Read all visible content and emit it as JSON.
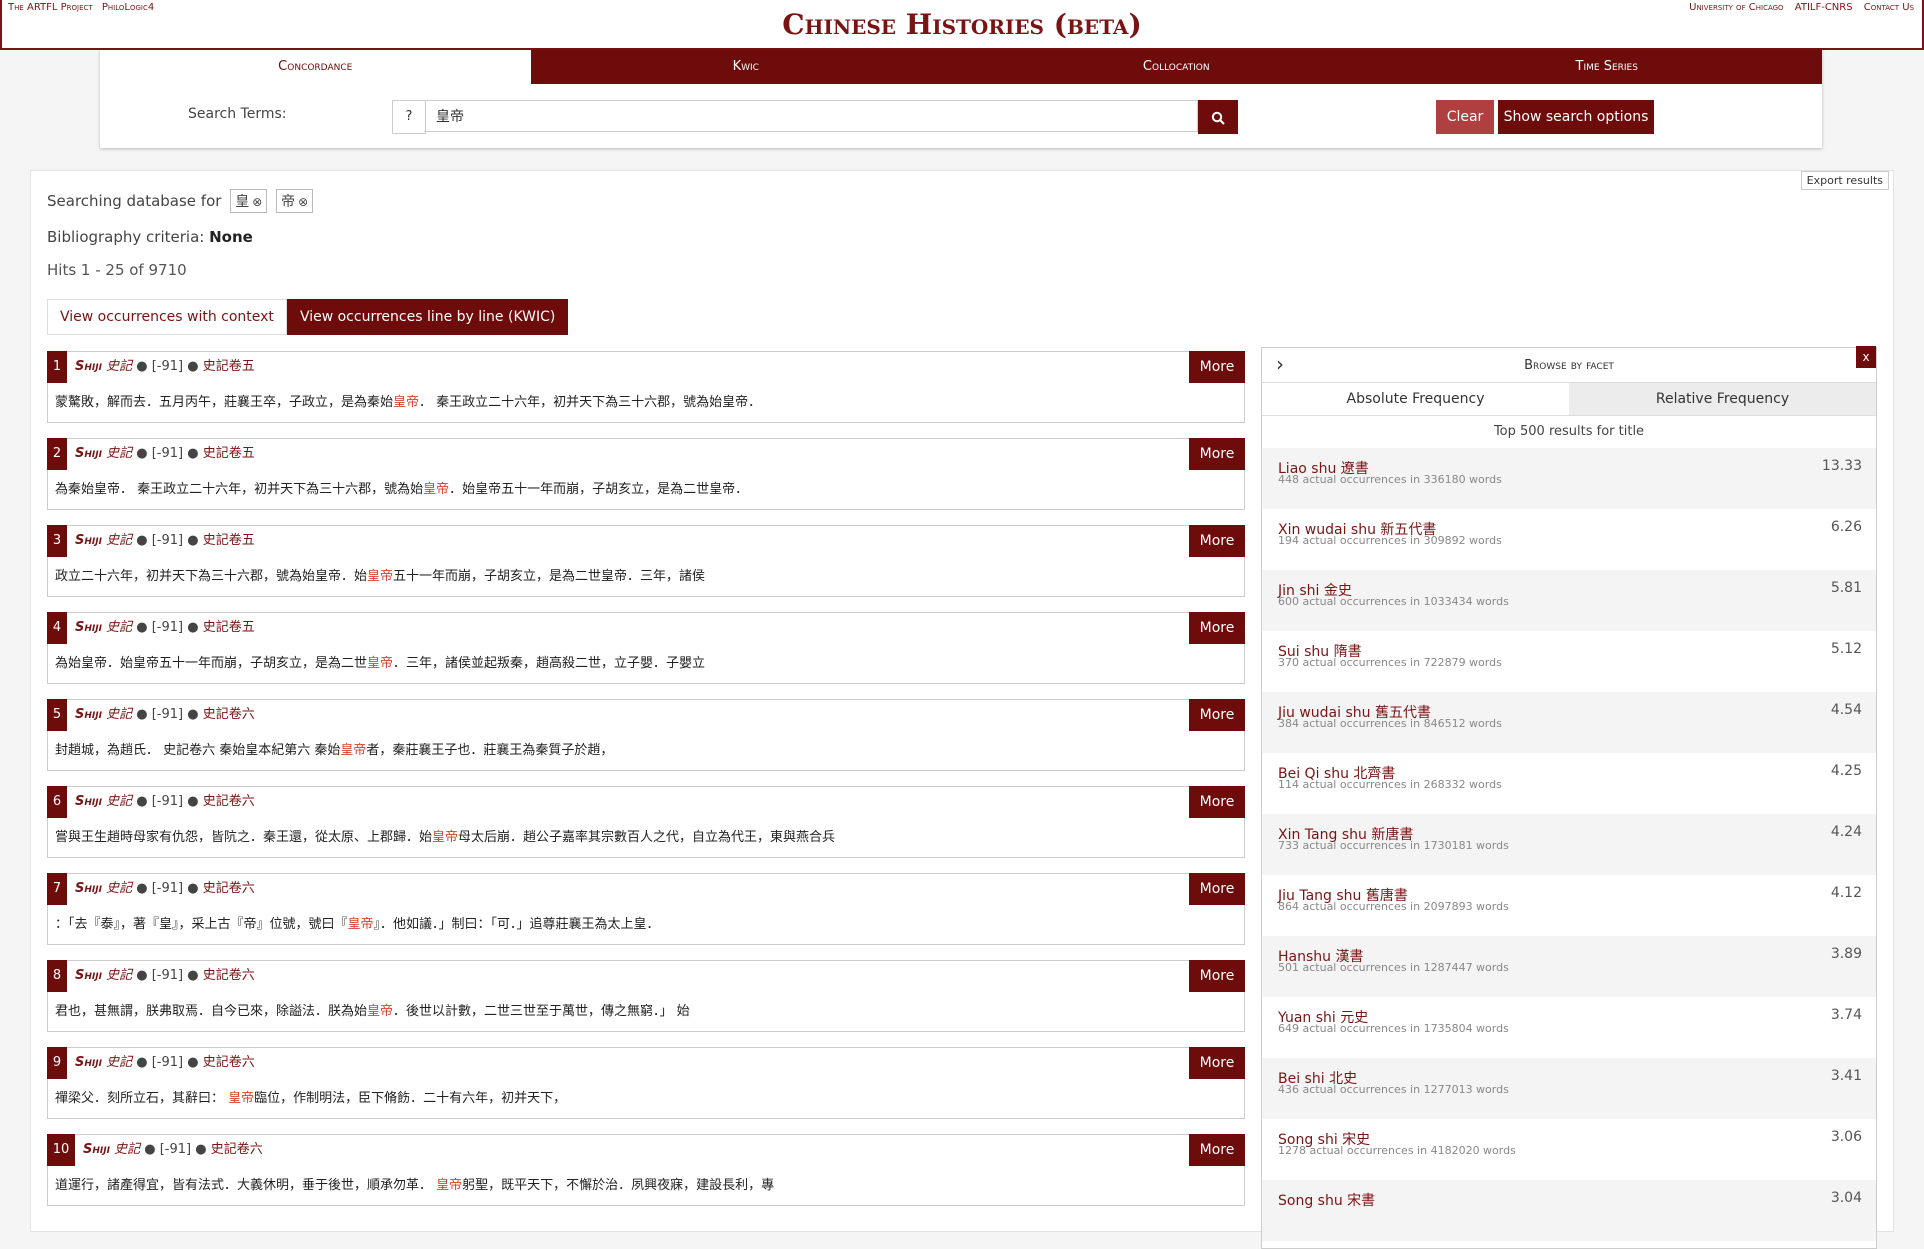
{
  "header": {
    "left_links": [
      "The ARTFL Project",
      "PhiloLogic4"
    ],
    "title": "Chinese Histories (beta)",
    "right_links": [
      "University of Chicago",
      "ATILF-CNRS",
      "Contact Us"
    ]
  },
  "search": {
    "tabs": [
      "Concordance",
      "Kwic",
      "Collocation",
      "Time Series"
    ],
    "label": "Search Terms:",
    "help": "?",
    "query": "皇帝",
    "clear": "Clear",
    "options": "Show search options"
  },
  "results": {
    "export": "Export results",
    "searching_prefix": "Searching database for",
    "terms": [
      "皇",
      "帝"
    ],
    "biblio_prefix": "Bibliography criteria:",
    "biblio_value": "None",
    "hits": "Hits 1 - 25 of 9710",
    "view_context": "View occurrences with context",
    "view_kwic": "View occurrences line by line (KWIC)",
    "more_label": "More",
    "hit_list": [
      {
        "num": "1",
        "book": "Shiji",
        "bookzh": "史記",
        "date": "[-91]",
        "vol": "史記卷五",
        "pre": "蒙驁敗，解而去．五月丙午，莊襄王卒，子政立，是為秦始",
        "kw": "皇帝",
        "post": "． 秦王政立二十六年，初并天下為三十六郡，號為始皇帝．"
      },
      {
        "num": "2",
        "book": "Shiji",
        "bookzh": "史記",
        "date": "[-91]",
        "vol": "史記卷五",
        "pre": "為秦始皇帝． 秦王政立二十六年，初并天下為三十六郡，號為始",
        "kw": "皇帝",
        "post": "．始皇帝五十一年而崩，子胡亥立，是為二世皇帝．"
      },
      {
        "num": "3",
        "book": "Shiji",
        "bookzh": "史記",
        "date": "[-91]",
        "vol": "史記卷五",
        "pre": "政立二十六年，初并天下為三十六郡，號為始皇帝．始",
        "kw": "皇帝",
        "post": "五十一年而崩，子胡亥立，是為二世皇帝．三年，諸侯"
      },
      {
        "num": "4",
        "book": "Shiji",
        "bookzh": "史記",
        "date": "[-91]",
        "vol": "史記卷五",
        "pre": "為始皇帝．始皇帝五十一年而崩，子胡亥立，是為二世",
        "kw": "皇帝",
        "post": "．三年，諸侯並起叛秦，趙高殺二世，立子嬰．子嬰立"
      },
      {
        "num": "5",
        "book": "Shiji",
        "bookzh": "史記",
        "date": "[-91]",
        "vol": "史記卷六",
        "pre": "封趙城，為趙氏． 史記卷六 秦始皇本紀第六 秦始",
        "kw": "皇帝",
        "post": "者，秦莊襄王子也．莊襄王為秦質子於趙，"
      },
      {
        "num": "6",
        "book": "Shiji",
        "bookzh": "史記",
        "date": "[-91]",
        "vol": "史記卷六",
        "pre": "嘗與王生趙時母家有仇怨，皆阬之．秦王還，從太原、上郡歸．始",
        "kw": "皇帝",
        "post": "母太后崩．趙公子嘉率其宗數百人之代，自立為代王，東與燕合兵"
      },
      {
        "num": "7",
        "book": "Shiji",
        "bookzh": "史記",
        "date": "[-91]",
        "vol": "史記卷六",
        "pre": "：「去『泰』，著『皇』，采上古『帝』位號，號曰『",
        "kw": "皇帝",
        "post": "』．他如議．」制曰：「可．」追尊莊襄王為太上皇．"
      },
      {
        "num": "8",
        "book": "Shiji",
        "bookzh": "史記",
        "date": "[-91]",
        "vol": "史記卷六",
        "pre": "君也，甚無謂，朕弗取焉．自今已來，除謚法．朕為始",
        "kw": "皇帝",
        "post": "．後世以計數，二世三世至于萬世，傳之無窮．」 始"
      },
      {
        "num": "9",
        "book": "Shiji",
        "bookzh": "史記",
        "date": "[-91]",
        "vol": "史記卷六",
        "pre": "禪梁父．刻所立石，其辭曰： ",
        "kw": "皇帝",
        "post": "臨位，作制明法，臣下脩飭．二十有六年，初并天下，"
      },
      {
        "num": "10",
        "book": "Shiji",
        "bookzh": "史記",
        "date": "[-91]",
        "vol": "史記卷六",
        "pre": "道運行，諸產得宜，皆有法式．大義休明，垂于後世，順承勿革． ",
        "kw": "皇帝",
        "post": "躬聖，既平天下，不懈於治．夙興夜寐，建設長利，專"
      }
    ]
  },
  "facet": {
    "title": "Browse by facet",
    "close": "x",
    "chevron": "chevron-right-icon",
    "tab_absolute": "Absolute Frequency",
    "tab_relative": "Relative Frequency",
    "top_label": "Top 500 results for title",
    "rows": [
      {
        "name": "Liao shu 遼書",
        "desc": "448 actual occurrences in 336180 words",
        "value": "13.33"
      },
      {
        "name": "Xin wudai shu 新五代書",
        "desc": "194 actual occurrences in 309892 words",
        "value": "6.26"
      },
      {
        "name": "Jin shi 金史",
        "desc": "600 actual occurrences in 1033434 words",
        "value": "5.81"
      },
      {
        "name": "Sui shu 隋書",
        "desc": "370 actual occurrences in 722879 words",
        "value": "5.12"
      },
      {
        "name": "Jiu wudai shu 舊五代書",
        "desc": "384 actual occurrences in 846512 words",
        "value": "4.54"
      },
      {
        "name": "Bei Qi shu 北齊書",
        "desc": "114 actual occurrences in 268332 words",
        "value": "4.25"
      },
      {
        "name": "Xin Tang shu 新唐書",
        "desc": "733 actual occurrences in 1730181 words",
        "value": "4.24"
      },
      {
        "name": "Jiu Tang shu 舊唐書",
        "desc": "864 actual occurrences in 2097893 words",
        "value": "4.12"
      },
      {
        "name": "Hanshu 漢書",
        "desc": "501 actual occurrences in 1287447 words",
        "value": "3.89"
      },
      {
        "name": "Yuan shi 元史",
        "desc": "649 actual occurrences in 1735804 words",
        "value": "3.74"
      },
      {
        "name": "Bei shi 北史",
        "desc": "436 actual occurrences in 1277013 words",
        "value": "3.41"
      },
      {
        "name": "Song shi 宋史",
        "desc": "1278 actual occurrences in 4182020 words",
        "value": "3.06"
      },
      {
        "name": "Song shu 宋書",
        "desc": "",
        "value": "3.04"
      }
    ]
  },
  "colors": {
    "accent": "#6e0b0b",
    "keyword": "#d9412b",
    "clear": "#b04040"
  }
}
